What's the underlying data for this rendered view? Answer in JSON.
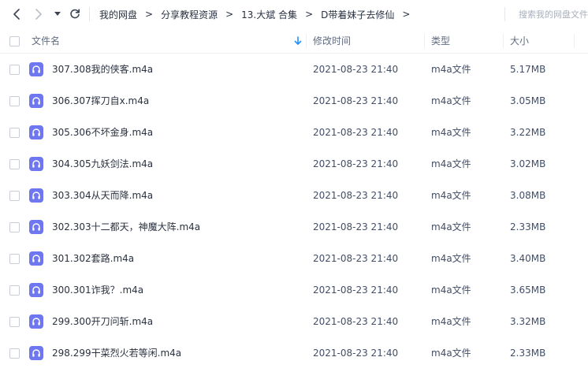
{
  "breadcrumb": [
    "我的网盘",
    "分享教程资源",
    "13.大斌 合集",
    "D带着妹子去修仙"
  ],
  "breadcrumb_separator": ">",
  "search": {
    "placeholder": "搜索我的网盘文件"
  },
  "columns": {
    "name": "文件名",
    "time": "修改时间",
    "type": "类型",
    "size": "大小"
  },
  "sort": {
    "column": "name",
    "icon": "sort-down-arrow-icon",
    "color": "#1e90ff"
  },
  "accent": {
    "file_icon_bg": "#6f77f0"
  },
  "files": [
    {
      "name": "307.308我的侠客.m4a",
      "time": "2021-08-23 21:40",
      "type": "m4a文件",
      "size": "5.17MB"
    },
    {
      "name": "306.307挥刀自x.m4a",
      "time": "2021-08-23 21:40",
      "type": "m4a文件",
      "size": "3.05MB"
    },
    {
      "name": "305.306不坏金身.m4a",
      "time": "2021-08-23 21:40",
      "type": "m4a文件",
      "size": "3.22MB"
    },
    {
      "name": "304.305九妖剑法.m4a",
      "time": "2021-08-23 21:40",
      "type": "m4a文件",
      "size": "3.02MB"
    },
    {
      "name": "303.304从天而降.m4a",
      "time": "2021-08-23 21:40",
      "type": "m4a文件",
      "size": "3.08MB"
    },
    {
      "name": "302.303十二都天，神魔大阵.m4a",
      "time": "2021-08-23 21:40",
      "type": "m4a文件",
      "size": "2.33MB"
    },
    {
      "name": "301.302套路.m4a",
      "time": "2021-08-23 21:40",
      "type": "m4a文件",
      "size": "3.40MB"
    },
    {
      "name": "300.301诈我？.m4a",
      "time": "2021-08-23 21:40",
      "type": "m4a文件",
      "size": "3.65MB"
    },
    {
      "name": "299.300开刀问斩.m4a",
      "time": "2021-08-23 21:40",
      "type": "m4a文件",
      "size": "3.32MB"
    },
    {
      "name": "298.299干菜烈火若等闲.m4a",
      "time": "2021-08-23 21:40",
      "type": "m4a文件",
      "size": "2.33MB"
    }
  ]
}
